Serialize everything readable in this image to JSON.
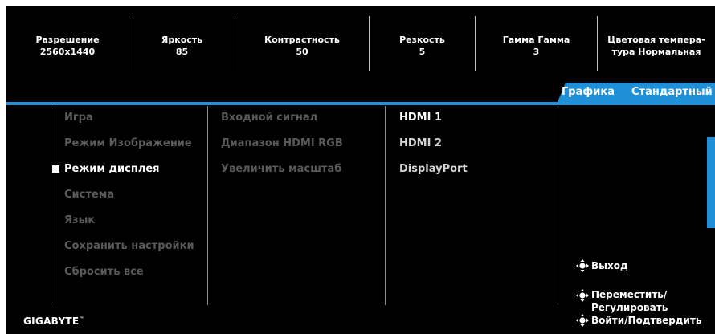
{
  "status_bar": [
    {
      "label": "Разрешение",
      "value": "2560x1440"
    },
    {
      "label": "Яркость",
      "value": "85"
    },
    {
      "label": "Контрастность",
      "value": "50"
    },
    {
      "label": "Резкость",
      "value": "5"
    },
    {
      "label": "Гамма Гамма",
      "value": "3"
    },
    {
      "label": "Цветовая темпера-",
      "value": "тура Нормальная"
    }
  ],
  "tabs": {
    "category": "Графика",
    "mode": "Стандартный"
  },
  "menu": {
    "main": [
      "Игра",
      "Режим Изображение",
      "Режим дисплея",
      "Система",
      "Язык",
      "Сохранить настройки",
      "Сбросить все"
    ],
    "selected_main": "Режим дисплея",
    "sub": [
      "Входной сигнал",
      "Диапазон HDMI RGB",
      "Увеличить масштаб"
    ],
    "options": [
      "HDMI 1",
      "HDMI 2",
      "DisplayPort"
    ],
    "selected_option": "HDMI 1"
  },
  "hints": {
    "exit": "Выход",
    "move_line1": "Переместить/",
    "move_line2": "Регулировать",
    "enter": "Войти/Подтвердить"
  },
  "brand": {
    "logo": "GIGABYTE",
    "trademark": "™"
  },
  "colors": {
    "accent": "#1f8fd8",
    "background": "#000000",
    "inactive_text": "#5a5a5a"
  }
}
